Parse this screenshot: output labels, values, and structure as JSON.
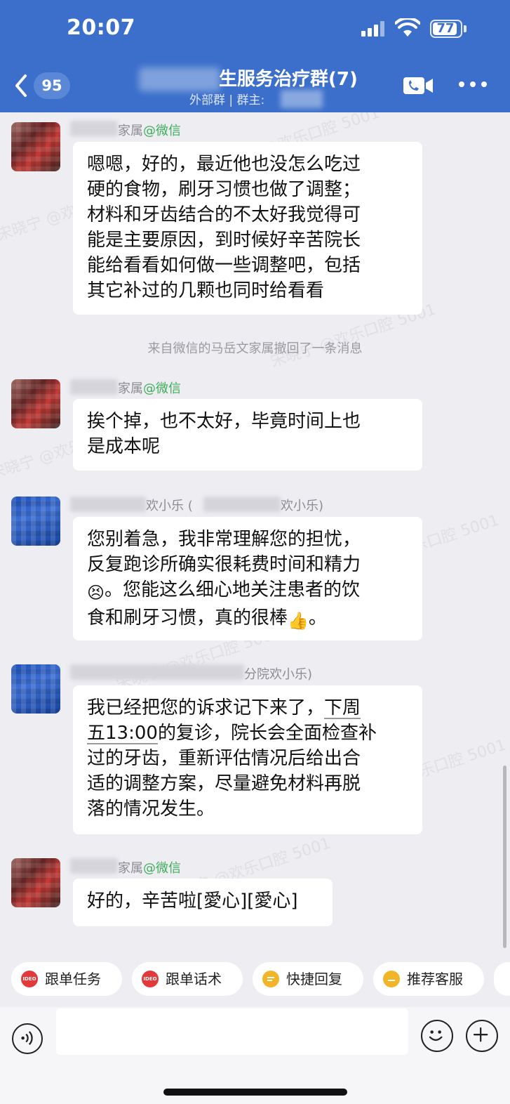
{
  "status_bar": {
    "time": "20:07",
    "battery": "77"
  },
  "header": {
    "unread_count": "95",
    "title": "生服务治疗群(7)",
    "subtitle": "外部群 | 群主:"
  },
  "watermark": "宋晓宁 @欢乐口腔 5001",
  "messages": [
    {
      "sender_suffix": "家属",
      "source": "@微信",
      "lines": [
        "嗯嗯，好的，最近他也没怎么吃过",
        "硬的食物，刷牙习惯也做了调整；",
        "材料和牙齿结合的不太好我觉得可",
        "能是主要原因，到时候好辛苦院长",
        "能给看看如何做一些调整吧，包括",
        "其它补过的几颗也同时给看看"
      ]
    },
    {
      "sender_suffix": "家属",
      "source": "@微信",
      "lines": [
        "挨个掉，也不太好，毕竟时间上也",
        "是成本呢"
      ]
    },
    {
      "sender_mid": "欢小乐 (",
      "sender_end": "欢小乐)",
      "lines": [
        "您别着急，我非常理解您的担忧，",
        "反复跑诊所确实很耗费时间和精力",
        "。您能这么细心地关注患者的饮",
        "食和刷牙习惯，真的很棒",
        "。"
      ]
    },
    {
      "sender_end": "分院欢小乐)",
      "line1_pre": "我已经把您的诉求记下来了，",
      "line1_ul": "下周",
      "line2_ul": "五13:00",
      "line2_post": "的复诊，院长会全面检查补",
      "lines": [
        "过的牙齿，重新评估情况后给出合",
        "适的调整方案，尽量避免材料再脱",
        "落的情况发生。"
      ]
    },
    {
      "sender_suffix": "家属",
      "source": "@微信",
      "lines": [
        "好的，辛苦啦[愛心][愛心]"
      ]
    }
  ],
  "system_message": "来自微信的马岳文家属撤回了一条消息",
  "emojis": {
    "sad": "😣",
    "thumbs_up": "👍"
  },
  "quick_actions": [
    {
      "label": "跟单任务",
      "icon": "IDEO"
    },
    {
      "label": "跟单话术",
      "icon": "IDEO"
    },
    {
      "label": "快捷回复",
      "icon": ""
    },
    {
      "label": "推荐客服",
      "icon": ""
    }
  ],
  "input": {
    "placeholder": ""
  },
  "colors": {
    "header": "#3b6fcb",
    "wechat_green": "#3fae5b",
    "chip_red": "#e23a3a",
    "chip_yellow": "#f2b52a"
  }
}
